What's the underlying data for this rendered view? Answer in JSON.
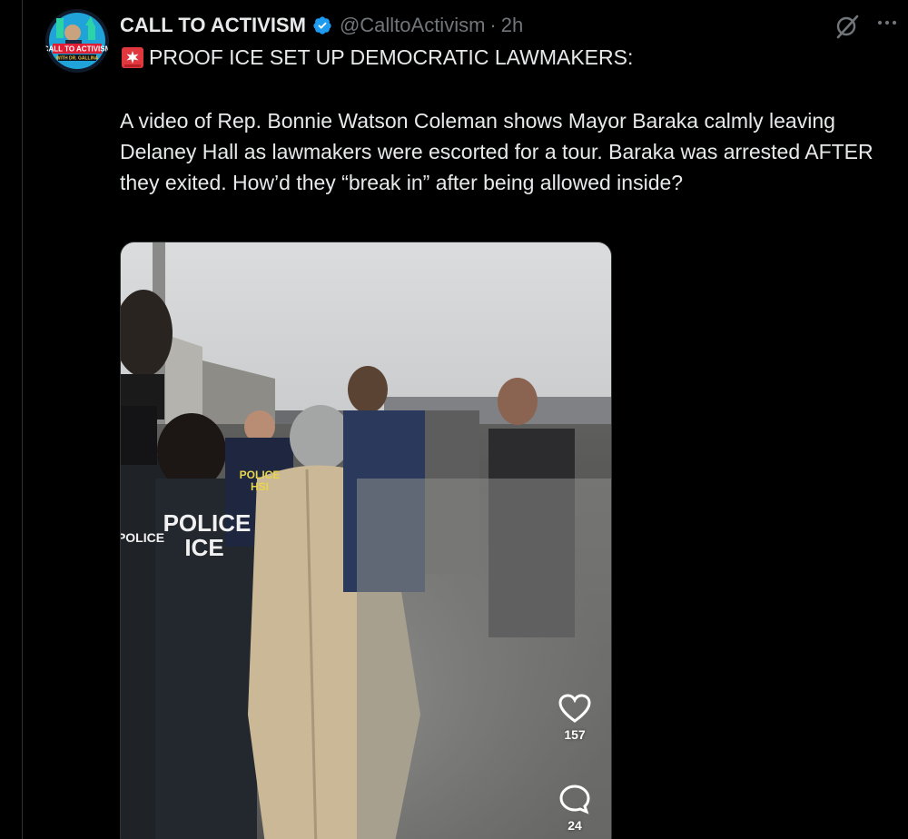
{
  "post": {
    "display_name": "CALL TO ACTIVISM",
    "handle": "@CalltoActivism",
    "separator": "·",
    "time": "2h",
    "headline": "PROOF ICE SET UP DEMOCRATIC LAWMAKERS:",
    "body": "A video of Rep. Bonnie Watson Coleman shows Mayor Baraka calmly leaving Delaney Hall as lawmakers were escorted for a tour. Baraka was arrested AFTER they exited. How’d they “break in” after being allowed inside?"
  },
  "avatar": {
    "logo_text": "CALL TO ACTIVISM",
    "logo_subtext": "WITH DR. GALLINA"
  },
  "video_overlay": {
    "likes": "157",
    "comments": "24",
    "jacket_text_1": "POLICE",
    "jacket_text_2": "HSI",
    "jacket_text_3": "POLICE",
    "jacket_text_4": "ICE",
    "jacket_text_5": "POLICE"
  },
  "icons": {
    "verified": "verified-badge-icon",
    "grok": "grok-icon",
    "more": "more-icon",
    "siren": "siren-emoji-icon",
    "like": "heart-icon",
    "comment": "comment-icon"
  },
  "colors": {
    "background": "#000000",
    "text_primary": "#e7e9ea",
    "text_secondary": "#71767b",
    "verified_blue": "#1d9bf0",
    "siren_red": "#e0383e"
  }
}
